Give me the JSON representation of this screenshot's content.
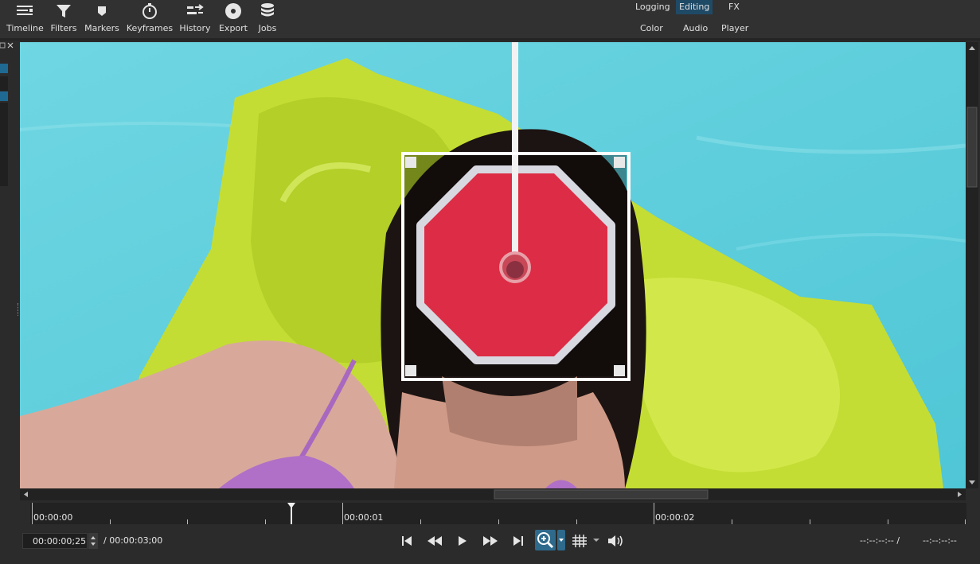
{
  "toolbar": {
    "items": [
      {
        "label": "Timeline",
        "icon": "timeline-icon"
      },
      {
        "label": "Filters",
        "icon": "filter-icon"
      },
      {
        "label": "Markers",
        "icon": "marker-icon"
      },
      {
        "label": "Keyframes",
        "icon": "stopwatch-icon"
      },
      {
        "label": "History",
        "icon": "history-icon"
      },
      {
        "label": "Export",
        "icon": "disc-icon"
      },
      {
        "label": "Jobs",
        "icon": "database-icon"
      }
    ],
    "layouts": [
      {
        "label": "Logging",
        "active": false
      },
      {
        "label": "Editing",
        "active": true
      },
      {
        "label": "FX",
        "active": false
      },
      {
        "label": "Color",
        "active": false
      },
      {
        "label": "Audio",
        "active": false
      },
      {
        "label": "Player",
        "active": false
      }
    ]
  },
  "ruler": {
    "labels": [
      "00:00:00",
      "00:00:01",
      "00:00:02"
    ]
  },
  "transport": {
    "current_time": "00:00:00;25",
    "duration": "/ 00:00:03;00",
    "in_point": "--:--:--:-- /",
    "out_point": "--:--:--:--"
  },
  "colors": {
    "accent": "#2e6a8c",
    "pool_water": "#5fcfdc",
    "float_green": "#c8e03a",
    "stop_red": "#dd2c45"
  }
}
